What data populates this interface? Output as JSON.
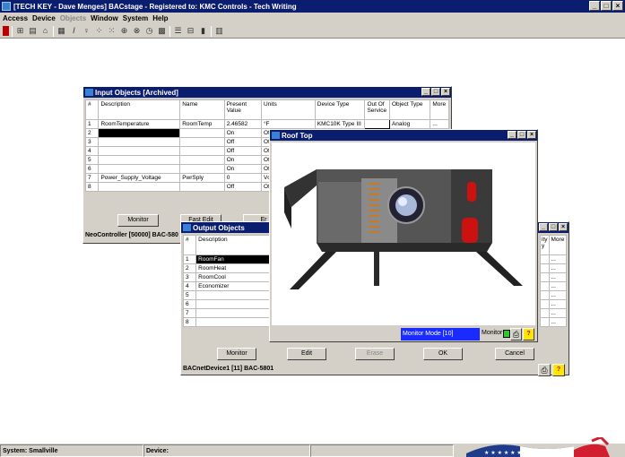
{
  "app": {
    "title": "[TECH KEY - Dave Menges]  BACstage - Registered to:  KMC Controls - Tech Writing",
    "menu": [
      {
        "label": "Access",
        "disabled": false
      },
      {
        "label": "Device",
        "disabled": false
      },
      {
        "label": "Objects",
        "disabled": true
      },
      {
        "label": "Window",
        "disabled": false
      },
      {
        "label": "System",
        "disabled": false
      },
      {
        "label": "Help",
        "disabled": false
      }
    ]
  },
  "status": {
    "system": "System: Smallville",
    "device": "Device:"
  },
  "input_window": {
    "title": "Input Objects [Archived]",
    "columns": [
      "#",
      "Description",
      "Name",
      "Present Value",
      "Units",
      "Device Type",
      "Out Of Service",
      "Object Type",
      "More"
    ],
    "rows": [
      [
        "1",
        "RoomTemperature",
        "RoomTemp",
        "2.46582",
        "°F",
        "KMC10K Type III",
        "",
        "Analog",
        "..."
      ],
      [
        "2",
        "",
        "",
        "On",
        "Of",
        "",
        "",
        "",
        ""
      ],
      [
        "3",
        "",
        "",
        "Off",
        "Of",
        "",
        "",
        "",
        ""
      ],
      [
        "4",
        "",
        "",
        "Off",
        "Of",
        "",
        "",
        "",
        ""
      ],
      [
        "5",
        "",
        "",
        "On",
        "Of",
        "",
        "",
        "",
        ""
      ],
      [
        "6",
        "",
        "",
        "On",
        "Of",
        "",
        "",
        "",
        ""
      ],
      [
        "7",
        "Power_Supply_Voltage",
        "PwrSply",
        "0",
        "Vc",
        "",
        "",
        "",
        ""
      ],
      [
        "8",
        "",
        "",
        "Off",
        "Of",
        "",
        "",
        "",
        ""
      ]
    ],
    "monitor_label": "Monitor",
    "edit_label": "Fast Edit",
    "extra_label": "Er",
    "footer": "NeoController [50000] BAC-580"
  },
  "output_window": {
    "title": "Output Objects",
    "columns": [
      "#",
      "Description"
    ],
    "rows": [
      [
        "1",
        "RoomFan"
      ],
      [
        "2",
        "RoomHeat"
      ],
      [
        "3",
        "RoomCool"
      ],
      [
        "4",
        "Economizer"
      ],
      [
        "5",
        ""
      ],
      [
        "6",
        ""
      ],
      [
        "7",
        ""
      ],
      [
        "8",
        ""
      ]
    ],
    "right_header_1": "ity",
    "right_header_2": "y",
    "right_header_more": "More",
    "more_cells": [
      "...",
      "...",
      "...",
      "...",
      "...",
      "...",
      "...",
      "..."
    ],
    "monitor_label": "Monitor",
    "edit_label": "Edit",
    "erase_label": "Erase",
    "ok_label": "OK",
    "cancel_label": "Cancel",
    "footer": "BACnetDevice1 [11]  BAC-5801"
  },
  "rooftop_window": {
    "title": "Roof Top",
    "status_text": "Monitor Mode [10]",
    "monitor_label": "Monitor"
  },
  "colors": {
    "titlebar": "#0a1d6e",
    "chrome": "#d4d0c8",
    "status_blue": "#1a2bff"
  }
}
